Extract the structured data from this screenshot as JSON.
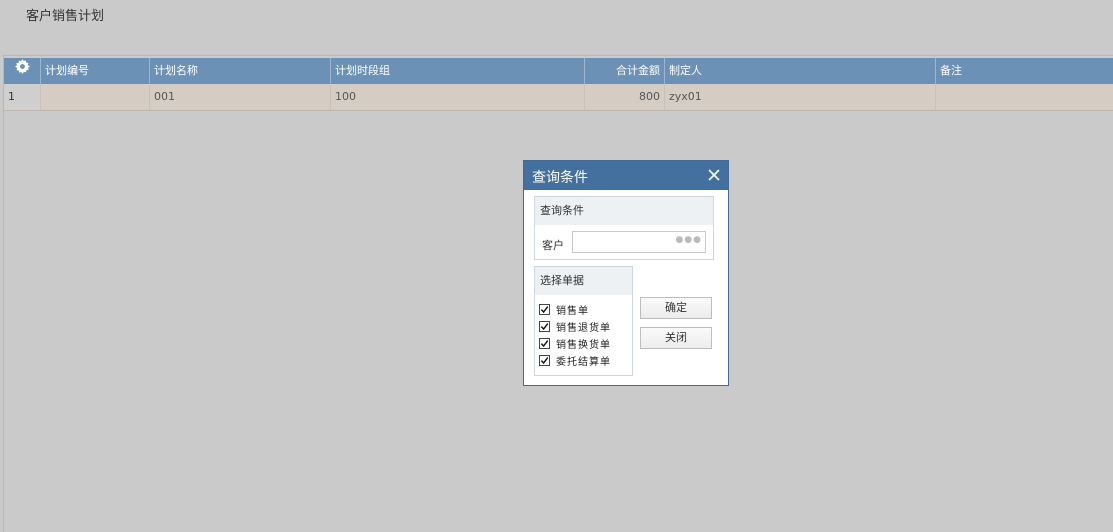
{
  "page": {
    "title": "客户销售计划"
  },
  "grid": {
    "settings_icon": "gear-icon",
    "columns": [
      "计划编号",
      "计划名称",
      "计划时段组",
      "合计金额",
      "制定人",
      "备注"
    ],
    "rows": [
      {
        "row_num": "1",
        "plan_code": "",
        "plan_name": "001",
        "period_group": "100",
        "total_amount": "800",
        "creator": "zyx01",
        "remark": ""
      }
    ]
  },
  "dialog": {
    "title": "查询条件",
    "close_icon": "close-icon",
    "query_section": {
      "title": "查询条件",
      "customer_label": "客户",
      "customer_value": "",
      "lookup_icon": "ellipsis-icon"
    },
    "select_section": {
      "title": "选择单据",
      "options": [
        {
          "label": "销售单",
          "checked": true
        },
        {
          "label": "销售退货单",
          "checked": true
        },
        {
          "label": "销售换货单",
          "checked": true
        },
        {
          "label": "委托结算单",
          "checked": true
        }
      ]
    },
    "ok_button": "确定",
    "close_button": "关闭"
  },
  "colors": {
    "header": "#6b91b6",
    "row_bg": "#d5cdc4",
    "dialog_title": "#43709e"
  }
}
